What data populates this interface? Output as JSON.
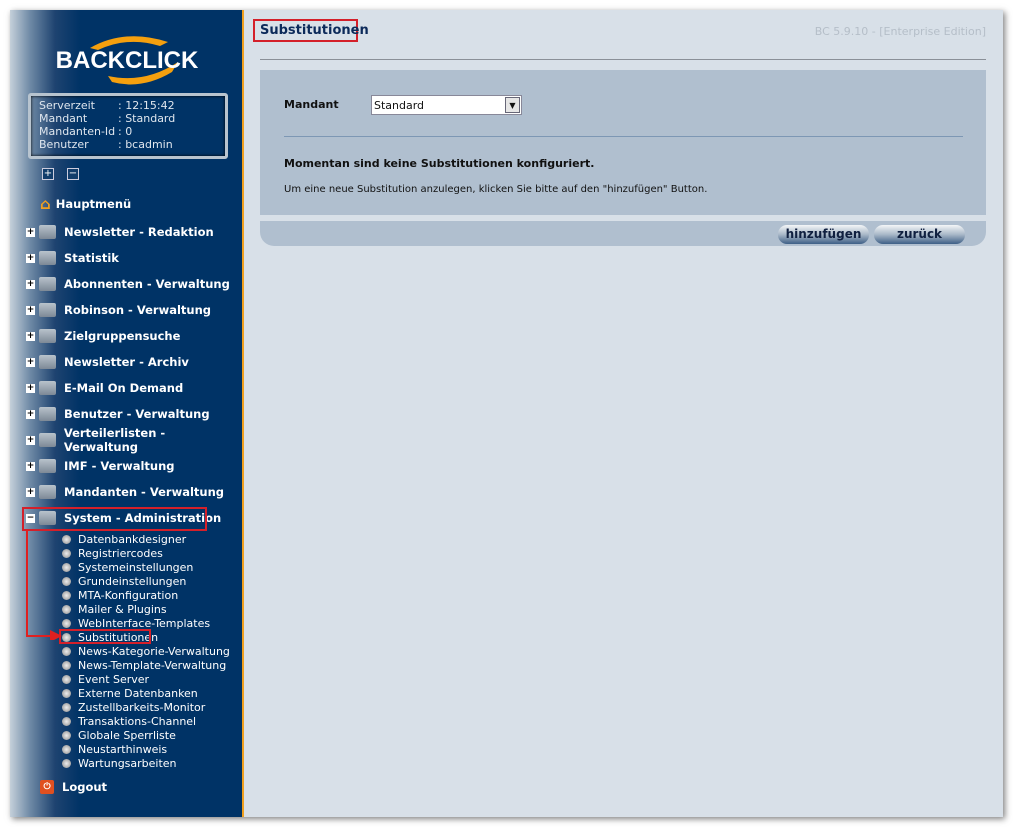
{
  "logo": "BACKCLICK",
  "info": [
    {
      "k": "Serverzeit",
      "v": ":  12:15:42"
    },
    {
      "k": "Mandant",
      "v": ": Standard"
    },
    {
      "k": "Mandanten-Id",
      "v": ": 0"
    },
    {
      "k": "Benutzer",
      "v": ": bcadmin"
    }
  ],
  "menu": {
    "home": "Hauptmenü",
    "items": [
      "Newsletter - Redaktion",
      "Statistik",
      "Abonnenten - Verwaltung",
      "Robinson - Verwaltung",
      "Zielgruppensuche",
      "Newsletter - Archiv",
      "E-Mail On Demand",
      "Benutzer - Verwaltung",
      "Verteilerlisten - Verwaltung",
      "IMF - Verwaltung",
      "Mandanten - Verwaltung"
    ],
    "open": "System - Administration",
    "sub": [
      "Datenbankdesigner",
      "Registriercodes",
      "Systemeinstellungen",
      "Grundeinstellungen",
      "MTA-Konfiguration",
      "Mailer & Plugins",
      "WebInterface-Templates",
      "Substitutionen",
      "News-Kategorie-Verwaltung",
      "News-Template-Verwaltung",
      "Event Server",
      "Externe Datenbanken",
      "Zustellbarkeits-Monitor",
      "Transaktions-Channel",
      "Globale Sperrliste",
      "Neustarthinweis",
      "Wartungsarbeiten"
    ],
    "logout": "Logout"
  },
  "main": {
    "title": "Substitutionen",
    "version": "BC 5.9.10 - [Enterprise Edition]",
    "mandant_label": "Mandant",
    "mandant_value": "Standard",
    "message": "Momentan sind keine Substitutionen konfiguriert.",
    "hint": "Um eine neue Substitution anzulegen, klicken Sie bitte auf den \"hinzufügen\" Button.",
    "add": "hinzufügen",
    "back": "zurück"
  },
  "colors": {
    "sidebar": "#003366",
    "accent": "#f0a020",
    "highlight": "#d4202a"
  }
}
